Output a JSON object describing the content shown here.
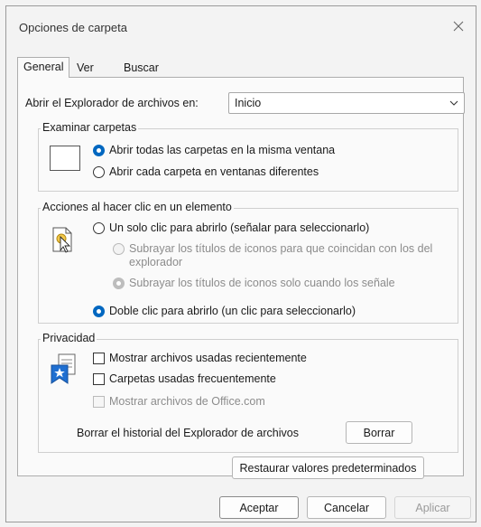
{
  "window": {
    "title": "Opciones de carpeta"
  },
  "tabs": [
    {
      "label": "General",
      "active": true
    },
    {
      "label": "Ver",
      "active": false
    },
    {
      "label": "Buscar",
      "active": false
    }
  ],
  "open_explorer": {
    "label": "Abrir el Explorador de archivos en:",
    "value": "Inicio"
  },
  "browse": {
    "legend": "Examinar carpetas",
    "option_same": "Abrir todas las carpetas en la misma ventana",
    "option_new": "Abrir cada carpeta en ventanas diferentes"
  },
  "click": {
    "legend": "Acciones al hacer clic en un elemento",
    "single": "Un solo clic para abrirlo (señalar para seleccionarlo)",
    "underline_consistent": "Subrayar los títulos de iconos para que coincidan con los del explorador",
    "underline_point": "Subrayar los títulos de iconos solo cuando los señale",
    "double": "Doble clic para abrirlo (un clic para seleccionarlo)"
  },
  "privacy": {
    "legend": "Privacidad",
    "recent_files": "Mostrar archivos usadas recientemente",
    "frequent_folders": "Carpetas usadas frecuentemente",
    "office_files": "Mostrar archivos de Office.com",
    "clear_label": "Borrar el historial del Explorador de archivos",
    "clear_button": "Borrar"
  },
  "restore_button": "Restaurar valores predeterminados",
  "footer": {
    "ok": "Aceptar",
    "cancel": "Cancelar",
    "apply": "Aplicar"
  },
  "colors": {
    "accent": "#0067c0"
  }
}
